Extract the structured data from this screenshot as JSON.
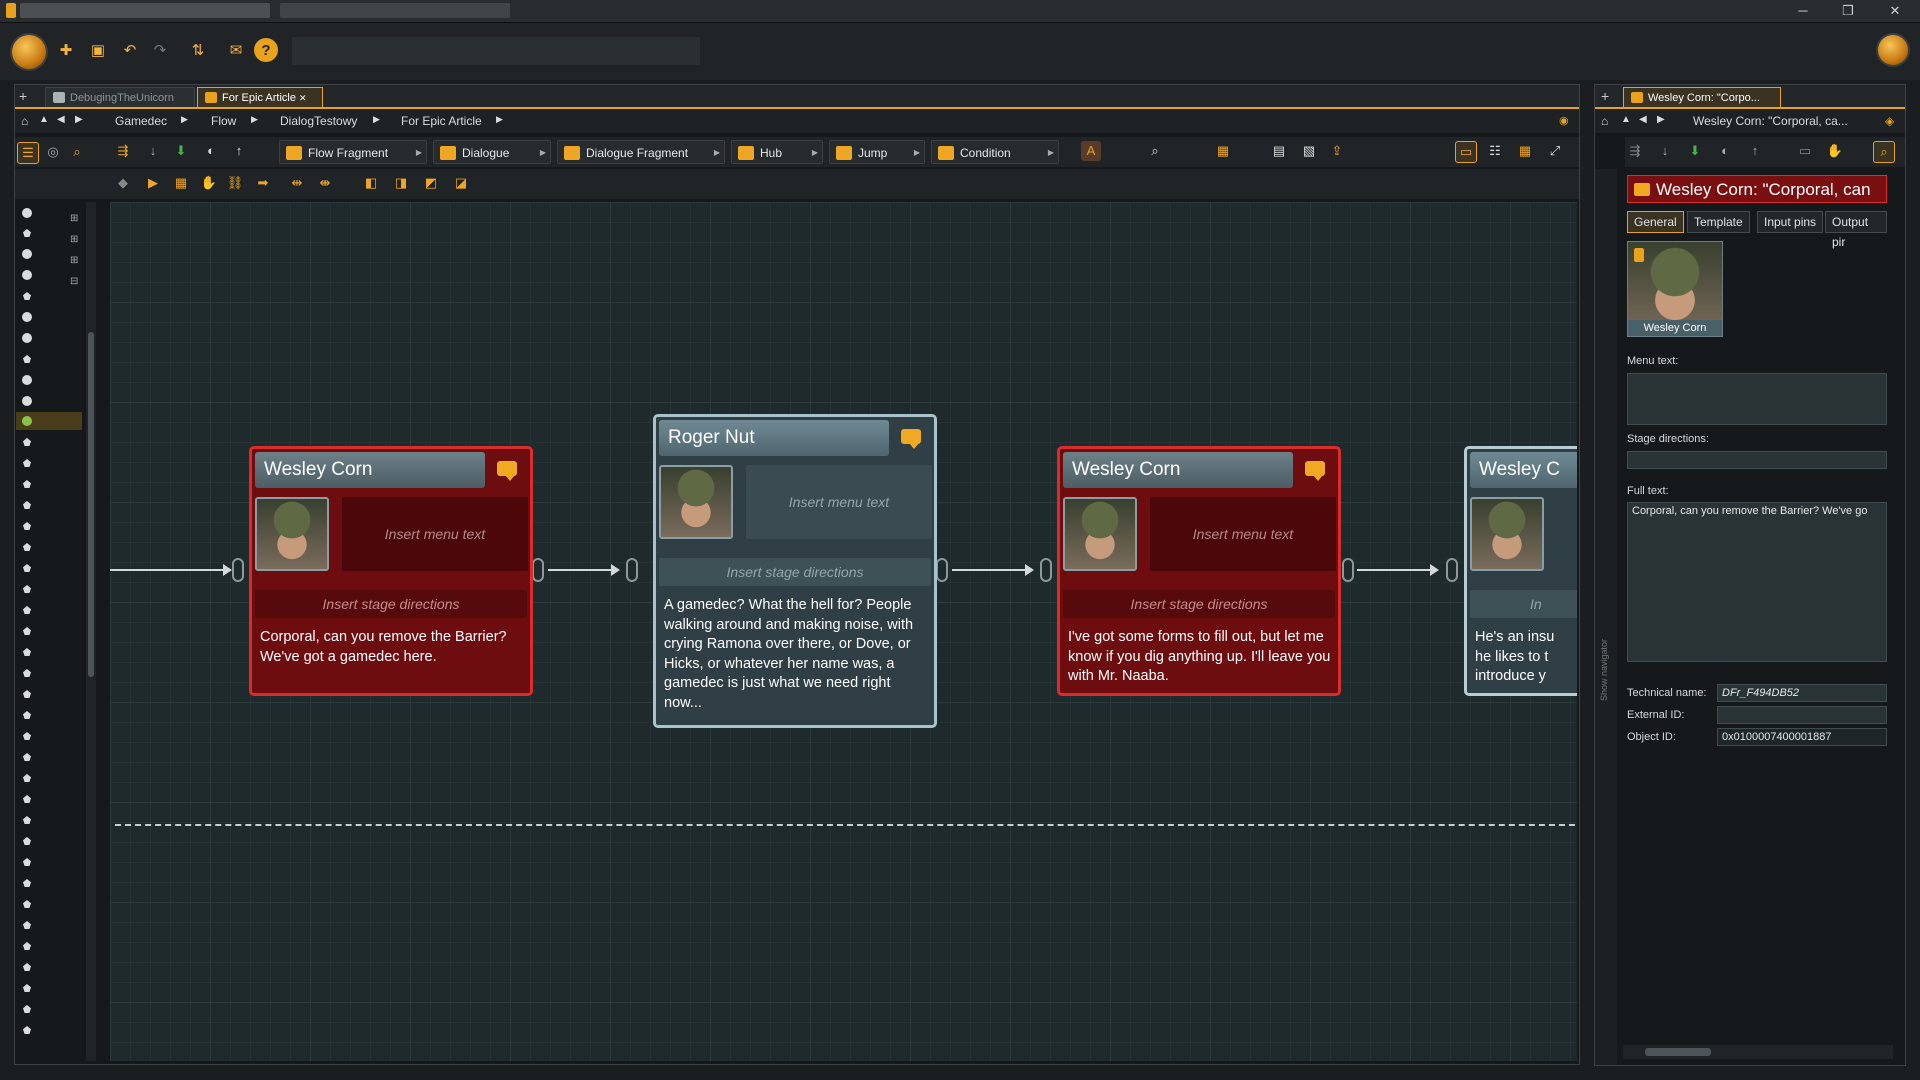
{
  "window": {
    "minimize": "─",
    "restore": "❐",
    "close": "✕"
  },
  "document_tabs": [
    {
      "label": "DebugingTheUnicorn",
      "active": false
    },
    {
      "label": "For Epic Article",
      "active": true,
      "close": "✕"
    }
  ],
  "breadcrumb": [
    "Gamedec",
    "Flow",
    "DialogTestowy",
    "For Epic Article"
  ],
  "create_tools": [
    {
      "label": "Flow Fragment"
    },
    {
      "label": "Dialogue"
    },
    {
      "label": "Dialogue Fragment"
    },
    {
      "label": "Hub"
    },
    {
      "label": "Jump"
    },
    {
      "label": "Condition"
    }
  ],
  "nodes": [
    {
      "speaker": "Wesley Corn",
      "menu_text": "Insert menu text",
      "stage": "Insert stage directions",
      "text": "Corporal, can you remove the Barrier? We've got a gamedec here."
    },
    {
      "speaker": "Roger Nut",
      "menu_text": "Insert menu text",
      "stage": "Insert stage directions",
      "text": "A gamedec? What the hell for? People walking around and making noise, with crying Ramona over there, or Dove, or Hicks, or whatever her name was, a gamedec is just what we need right now..."
    },
    {
      "speaker": "Wesley Corn",
      "menu_text": "Insert menu text",
      "stage": "Insert stage directions",
      "text": "I've got some forms to fill out, but let me know if you dig anything up. I'll leave you with Mr. Naaba."
    },
    {
      "speaker": "Wesley C",
      "stage": "In",
      "text": "He's an insu he likes to t introduce y"
    }
  ],
  "inspector": {
    "tab_label": "Wesley Corn: \"Corpo...",
    "crumb": "Wesley Corn: \"Corporal, ca...",
    "header": "Wesley Corn: \"Corporal, can",
    "tabs": [
      "General",
      "Template",
      "Input pins",
      "Output pir"
    ],
    "portrait_name": "Wesley Corn",
    "menu_text_label": "Menu text:",
    "stage_label": "Stage directions:",
    "full_text_label": "Full text:",
    "full_text": "Corporal, can you remove the Barrier? We've go",
    "tech_label": "Technical name:",
    "tech_value": "DFr_F494DB52",
    "ext_label": "External ID:",
    "ext_value": "",
    "obj_label": "Object ID:",
    "obj_value": "0x0100007400001887",
    "navigator": "Show navigator"
  },
  "colors": {
    "accent": "#e8a21b",
    "node_red": "#6e0d10",
    "node_red_border": "#d92d2d",
    "node_blue": "#2f3f45"
  }
}
